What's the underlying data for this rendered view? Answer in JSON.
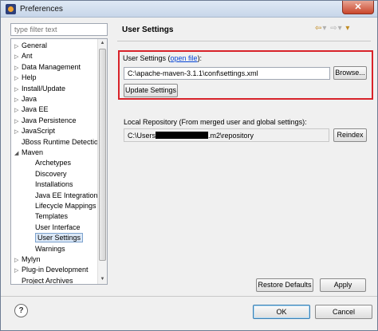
{
  "window": {
    "title": "Preferences",
    "close_label": "✕"
  },
  "filter": {
    "placeholder": "type filter text"
  },
  "tree": [
    {
      "label": "General",
      "expander": "▷",
      "level": 0
    },
    {
      "label": "Ant",
      "expander": "▷",
      "level": 0
    },
    {
      "label": "Data Management",
      "expander": "▷",
      "level": 0
    },
    {
      "label": "Help",
      "expander": "▷",
      "level": 0
    },
    {
      "label": "Install/Update",
      "expander": "▷",
      "level": 0
    },
    {
      "label": "Java",
      "expander": "▷",
      "level": 0
    },
    {
      "label": "Java EE",
      "expander": "▷",
      "level": 0
    },
    {
      "label": "Java Persistence",
      "expander": "▷",
      "level": 0
    },
    {
      "label": "JavaScript",
      "expander": "▷",
      "level": 0
    },
    {
      "label": "JBoss Runtime Detection",
      "expander": "",
      "level": 0
    },
    {
      "label": "Maven",
      "expander": "◢",
      "level": 0
    },
    {
      "label": "Archetypes",
      "expander": "",
      "level": 1
    },
    {
      "label": "Discovery",
      "expander": "",
      "level": 1
    },
    {
      "label": "Installations",
      "expander": "",
      "level": 1
    },
    {
      "label": "Java EE Integration",
      "expander": "",
      "level": 1
    },
    {
      "label": "Lifecycle Mappings",
      "expander": "",
      "level": 1
    },
    {
      "label": "Templates",
      "expander": "",
      "level": 1
    },
    {
      "label": "User Interface",
      "expander": "",
      "level": 1
    },
    {
      "label": "User Settings",
      "expander": "",
      "level": 1,
      "selected": true
    },
    {
      "label": "Warnings",
      "expander": "",
      "level": 1
    },
    {
      "label": "Mylyn",
      "expander": "▷",
      "level": 0
    },
    {
      "label": "Plug-in Development",
      "expander": "▷",
      "level": 0
    },
    {
      "label": "Project Archives",
      "expander": "",
      "level": 0
    }
  ],
  "page": {
    "title": "User Settings",
    "nav_back": "⇦",
    "nav_back_menu": "▾",
    "nav_forward": "⇨",
    "nav_forward_menu": "▾",
    "menu": "▾"
  },
  "user_settings": {
    "label": "User Settings",
    "open_link_open": " (",
    "open_link": "open file",
    "open_link_close": "):",
    "path": "C:\\apache-maven-3.1.1\\conf\\settings.xml",
    "browse_label": "Browse..."
  },
  "update_label": "Update Settings",
  "local_repo": {
    "label": "Local Repository (From merged user and global settings):",
    "path_prefix": "C:\\Users",
    "path_suffix": ".m2\\repository",
    "reindex_label": "Reindex"
  },
  "restore_label": "Restore Defaults",
  "apply_label": "Apply",
  "ok_label": "OK",
  "cancel_label": "Cancel",
  "help_label": "?",
  "colors": {
    "highlight": "#d8232a",
    "link": "#0645d6",
    "selection": "#dbe8f7"
  }
}
